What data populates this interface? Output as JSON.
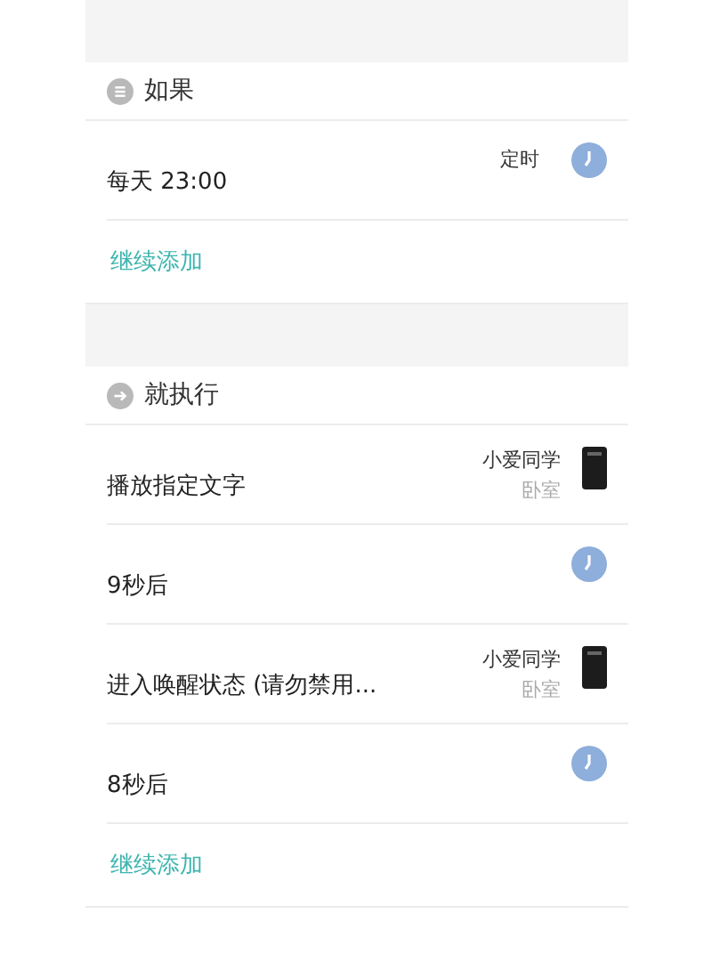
{
  "sections": [
    {
      "title": "如果",
      "kind": "condition",
      "rows": [
        {
          "kind": "timer",
          "text": "每天 23:00",
          "label": "定时"
        }
      ],
      "add": "继续添加"
    },
    {
      "title": "就执行",
      "kind": "action",
      "rows": [
        {
          "kind": "device",
          "text": "播放指定文字",
          "device": "小爱同学",
          "room": "卧室"
        },
        {
          "kind": "timer",
          "text": "9秒后"
        },
        {
          "kind": "device",
          "text": "进入唤醒状态 (请勿禁用...",
          "device": "小爱同学",
          "room": "卧室"
        },
        {
          "kind": "timer",
          "text": "8秒后"
        }
      ],
      "add": "继续添加"
    }
  ]
}
